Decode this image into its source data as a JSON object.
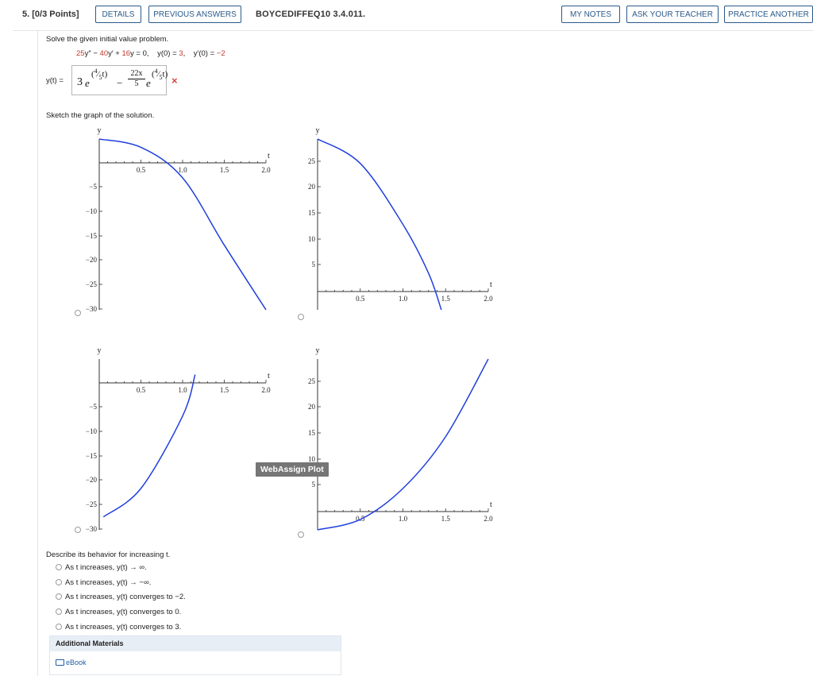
{
  "header": {
    "question_number": "5.",
    "points": "[0/3 Points]",
    "details_label": "DETAILS",
    "previous_answers_label": "PREVIOUS ANSWERS",
    "question_id": "BOYCEDIFFEQ10 3.4.011.",
    "my_notes_label": "MY NOTES",
    "ask_teacher_label": "ASK YOUR TEACHER",
    "practice_another_label": "PRACTICE ANOTHER"
  },
  "problem": {
    "prompt": "Solve the given initial value problem.",
    "eq_coef_a": "25",
    "eq_term_a": "y″ − ",
    "eq_coef_b": "40",
    "eq_term_b": "y′ + ",
    "eq_coef_c": "16",
    "eq_term_c": "y = 0,",
    "ic1": "y(0) = 3,",
    "ic2": "y′(0) = −2"
  },
  "answer": {
    "label": "y(t) =",
    "coef1": "3",
    "base1": "e",
    "exp1": "(4/5 t)",
    "minus": "−",
    "frac_num": "22x",
    "frac_den": "5",
    "base2": "e",
    "exp2": "(4/5 t)",
    "status": "incorrect",
    "status_icon": "×"
  },
  "sketch_prompt": "Sketch the graph of the solution.",
  "graph_tooltip": "WebAssign Plot",
  "graphs": [
    {
      "y_label": "y",
      "x_label": "t",
      "x_ticks": [
        "0.5",
        "1.0",
        "1.5",
        "2.0"
      ],
      "y_ticks": [
        "-5",
        "-10",
        "-15",
        "-20",
        "-25",
        "-30"
      ],
      "curve_color": "#1f3fdd",
      "chart_data": {
        "type": "line",
        "x": [
          0,
          0.5,
          1.0,
          1.5,
          2.0
        ],
        "y": [
          3,
          1.4,
          -4.5,
          -17.5,
          -30
        ],
        "xlim": [
          0,
          2.0
        ],
        "ylim": [
          -30,
          3
        ]
      }
    },
    {
      "y_label": "y",
      "x_label": "t",
      "x_ticks": [
        "0.5",
        "1.0",
        "1.5",
        "2.0"
      ],
      "y_ticks": [
        "25",
        "20",
        "15",
        "10",
        "5"
      ],
      "curve_color": "#1f3fdd",
      "chart_data": {
        "type": "line",
        "x": [
          0,
          0.5,
          1.0,
          1.3,
          1.45
        ],
        "y": [
          28,
          24,
          14,
          6,
          0
        ],
        "xlim": [
          0,
          2.0
        ],
        "ylim": [
          0,
          28
        ]
      }
    },
    {
      "y_label": "y",
      "x_label": "t",
      "x_ticks": [
        "0.5",
        "1.0",
        "1.5",
        "2.0"
      ],
      "y_ticks": [
        "-5",
        "-10",
        "-15",
        "-20",
        "-25",
        "-30"
      ],
      "curve_color": "#1f3fdd",
      "chart_data": {
        "type": "line",
        "x": [
          0.05,
          0.5,
          1.0,
          1.15
        ],
        "y": [
          -27.5,
          -22,
          -8,
          0
        ],
        "xlim": [
          0,
          2.0
        ],
        "ylim": [
          -30,
          3
        ]
      }
    },
    {
      "y_label": "y",
      "x_label": "t",
      "x_ticks": [
        "0.5",
        "1.0",
        "1.5",
        "2.0"
      ],
      "y_ticks": [
        "25",
        "20",
        "15",
        "10",
        "5"
      ],
      "curve_color": "#1f3fdd",
      "chart_data": {
        "type": "line",
        "x": [
          0,
          0.5,
          1.0,
          1.5,
          2.0
        ],
        "y": [
          -3,
          -1,
          5,
          15,
          30
        ],
        "xlim": [
          0,
          2.0
        ],
        "ylim": [
          -3,
          30
        ]
      }
    }
  ],
  "behavior": {
    "prompt": "Describe its behavior for increasing t.",
    "options": [
      "As t increases, y(t) → ∞.",
      "As t increases, y(t) → −∞.",
      "As t increases, y(t) converges to −2.",
      "As t increases, y(t) converges to 0.",
      "As t increases, y(t) converges to 3."
    ]
  },
  "additional": {
    "title": "Additional Materials",
    "ebook_label": "eBook"
  }
}
